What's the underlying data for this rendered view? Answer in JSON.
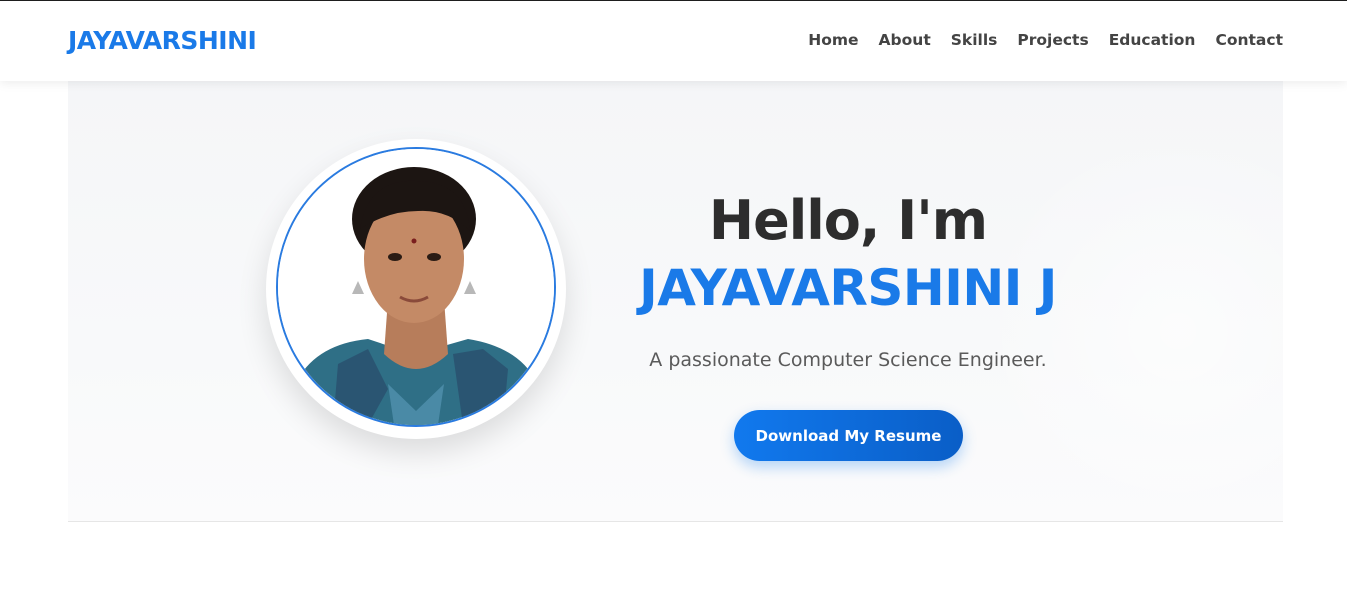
{
  "header": {
    "brand": "JAYAVARSHINI",
    "nav": [
      {
        "label": "Home"
      },
      {
        "label": "About"
      },
      {
        "label": "Skills"
      },
      {
        "label": "Projects"
      },
      {
        "label": "Education"
      },
      {
        "label": "Contact"
      }
    ]
  },
  "hero": {
    "greeting": "Hello, I'm",
    "name": "JAYAVARSHINI J",
    "tagline": "A passionate Computer Science Engineer.",
    "cta_label": "Download My Resume"
  },
  "colors": {
    "accent": "#1a7ae8",
    "heading": "#2d2d2d",
    "text": "#5a5a5a",
    "nav_text": "#444444"
  }
}
